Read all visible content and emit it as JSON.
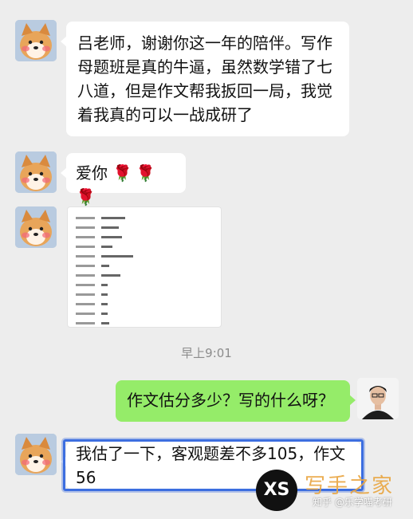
{
  "chat": {
    "messages": [
      {
        "id": "m1",
        "side": "left",
        "text": "吕老师，谢谢你这一年的陪伴。写作母题班是真的牛逼，虽然数学错了七八道，但是作文帮我扳回一局，我觉着我真的可以一战成研了"
      },
      {
        "id": "m2",
        "side": "left",
        "text": "爱你",
        "emoji": "🌹🌹🌹"
      },
      {
        "id": "m3",
        "side": "left",
        "type": "image"
      },
      {
        "id": "m4",
        "side": "right",
        "text": "作文估分多少？写的什么呀？"
      },
      {
        "id": "m5",
        "side": "left",
        "text": "我估了一下，客观题差不多105，作文56",
        "highlighted": true
      }
    ],
    "timestamp": "早上9:01"
  },
  "watermark": {
    "badge": "XS",
    "title": "写手之家",
    "sub": "知乎 @乐学喵考研"
  },
  "colors": {
    "background": "#ededed",
    "bubble_incoming": "#ffffff",
    "bubble_outgoing": "#95ec69",
    "highlight_border": "#3c6ee0"
  }
}
